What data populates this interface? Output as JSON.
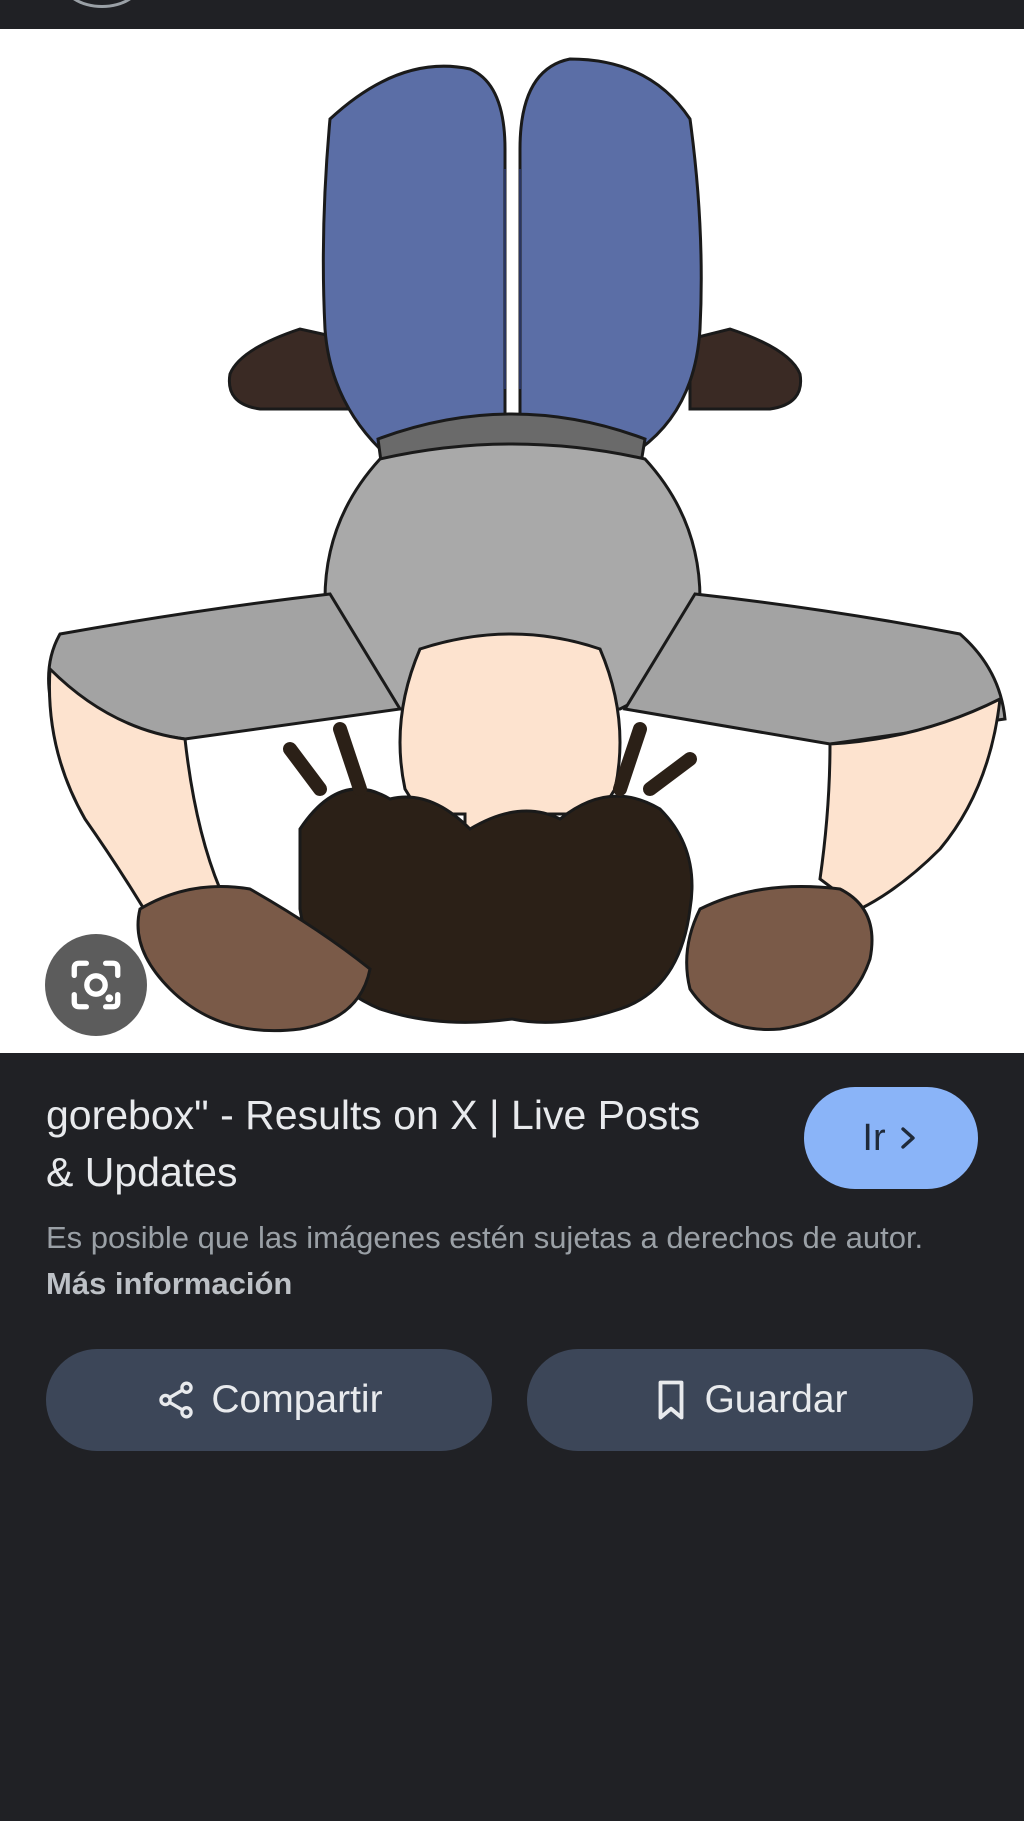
{
  "header": {
    "icon": "avatar-arc-icon"
  },
  "image": {
    "alt": "",
    "lens_icon": "google-lens-icon"
  },
  "result": {
    "title": "gorebox\" - Results on X | Live Posts & Updates",
    "go_label": "Ir",
    "go_icon": "chevron-right-icon",
    "notice_text": "Es posible que las imágenes estén sujetas a derechos de autor. ",
    "more_info_label": "Más información"
  },
  "actions": {
    "share_label": "Compartir",
    "share_icon": "share-icon",
    "save_label": "Guardar",
    "save_icon": "bookmark-icon"
  },
  "colors": {
    "background": "#202125",
    "accent": "#8ab4f8",
    "action_button": "#3c4658"
  }
}
